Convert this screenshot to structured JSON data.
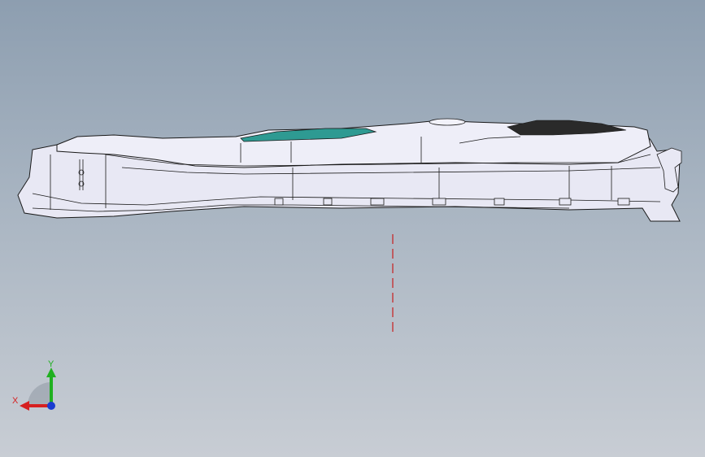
{
  "viewport": {
    "background_top": "#8d9eb0",
    "background_bottom": "#c8cdd4"
  },
  "model": {
    "name": "part-side-view",
    "body_color": "#e6e6f2",
    "edge_color": "#1a1a1a",
    "accent_color": "#2e9a92",
    "texture_color": "#2a2a2a"
  },
  "sketch": {
    "centerline_color": "#c81e1e"
  },
  "triad": {
    "x_label": "X",
    "y_label": "Y",
    "x_color": "#d62020",
    "y_color": "#20b020",
    "z_color": "#1a3cd0"
  }
}
